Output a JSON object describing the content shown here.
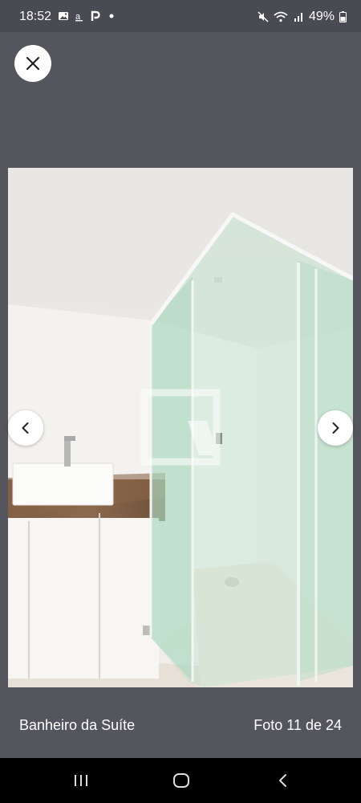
{
  "status_bar": {
    "time": "18:52",
    "battery": "49%",
    "left_icons": [
      "image-icon",
      "a-icon",
      "p-icon",
      "dot-icon"
    ],
    "right_icons": [
      "mute-icon",
      "wifi-icon",
      "signal-icon",
      "battery-icon"
    ]
  },
  "gallery": {
    "caption": "Banheiro da Suíte",
    "counter": "Foto 11 de 24",
    "close_icon": "close-icon",
    "prev_icon": "chevron-left-icon",
    "next_icon": "chevron-right-icon"
  },
  "system_nav": {
    "icons": [
      "recents-icon",
      "home-icon",
      "back-icon"
    ]
  },
  "colors": {
    "background": "#55555e",
    "status_bar": "#4a4a52",
    "nav_bar": "#000000"
  }
}
